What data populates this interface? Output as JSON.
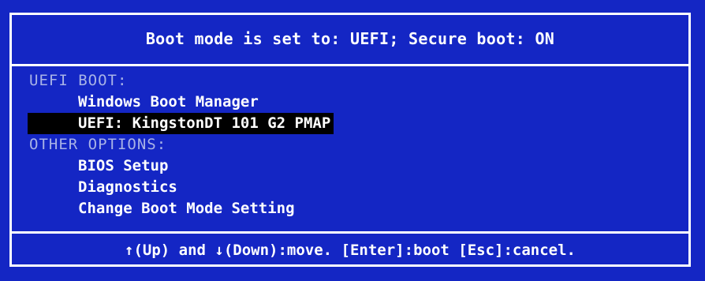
{
  "header": {
    "text": "Boot mode is set to: UEFI; Secure boot: ON"
  },
  "menu": {
    "sections": [
      {
        "label": "UEFI BOOT:",
        "items": [
          {
            "label": "Windows Boot Manager",
            "selected": false
          },
          {
            "label": "UEFI: KingstonDT 101 G2 PMAP",
            "selected": true
          }
        ]
      },
      {
        "label": "OTHER OPTIONS:",
        "items": [
          {
            "label": "BIOS Setup",
            "selected": false
          },
          {
            "label": "Diagnostics",
            "selected": false
          },
          {
            "label": "Change Boot Mode Setting",
            "selected": false
          }
        ]
      }
    ]
  },
  "footer": {
    "text": "↑(Up) and ↓(Down):move. [Enter]:boot [Esc]:cancel."
  },
  "colors": {
    "background": "#1426c4",
    "text": "#ffffff",
    "section_text": "#a9b3e6",
    "selection": "#000000"
  }
}
